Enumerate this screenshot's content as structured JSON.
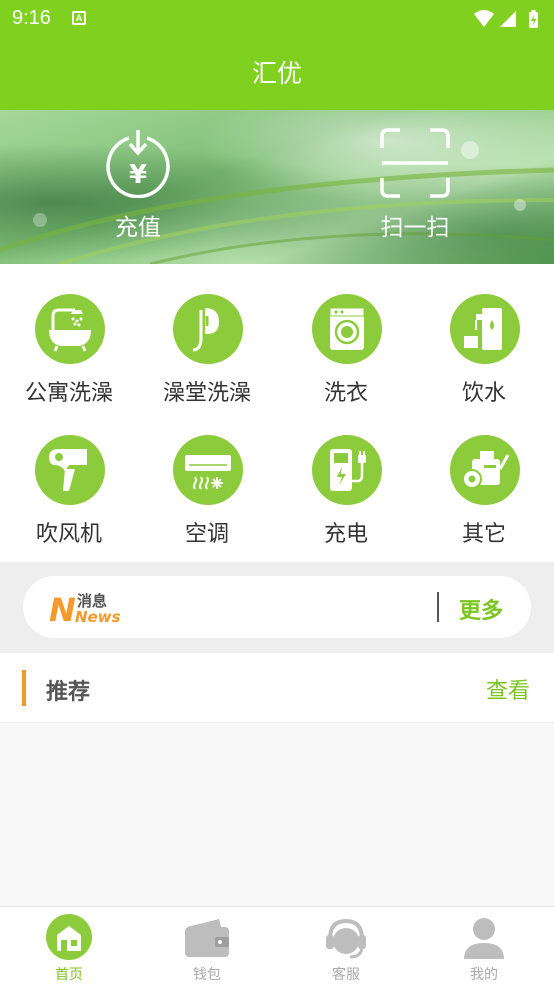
{
  "status_bar": {
    "time": "9:16",
    "notification_badge": "A"
  },
  "header": {
    "title": "汇优"
  },
  "banner": {
    "recharge_label": "充值",
    "recharge_symbol": "¥",
    "scan_label": "扫一扫"
  },
  "services": [
    {
      "label": "公寓洗澡",
      "icon": "apartment-bath-icon"
    },
    {
      "label": "澡堂洗澡",
      "icon": "shower-icon"
    },
    {
      "label": "洗衣",
      "icon": "washing-machine-icon"
    },
    {
      "label": "饮水",
      "icon": "water-dispenser-icon"
    },
    {
      "label": "吹风机",
      "icon": "hair-dryer-icon"
    },
    {
      "label": "空调",
      "icon": "air-conditioner-icon"
    },
    {
      "label": "充电",
      "icon": "charging-icon"
    },
    {
      "label": "其它",
      "icon": "other-icon"
    }
  ],
  "news": {
    "logo_top": "消息",
    "logo_bottom": "News",
    "more_label": "更多"
  },
  "recommend": {
    "title": "推荐",
    "view_label": "查看"
  },
  "tabbar": {
    "tabs": [
      {
        "label": "首页",
        "icon": "home-icon",
        "active": true
      },
      {
        "label": "钱包",
        "icon": "wallet-icon",
        "active": false
      },
      {
        "label": "客服",
        "icon": "headset-icon",
        "active": false
      },
      {
        "label": "我的",
        "icon": "user-icon",
        "active": false
      }
    ]
  },
  "colors": {
    "brand_green": "#80d11f",
    "icon_green": "#8ccc3c",
    "accent_orange": "#f39a2b"
  }
}
